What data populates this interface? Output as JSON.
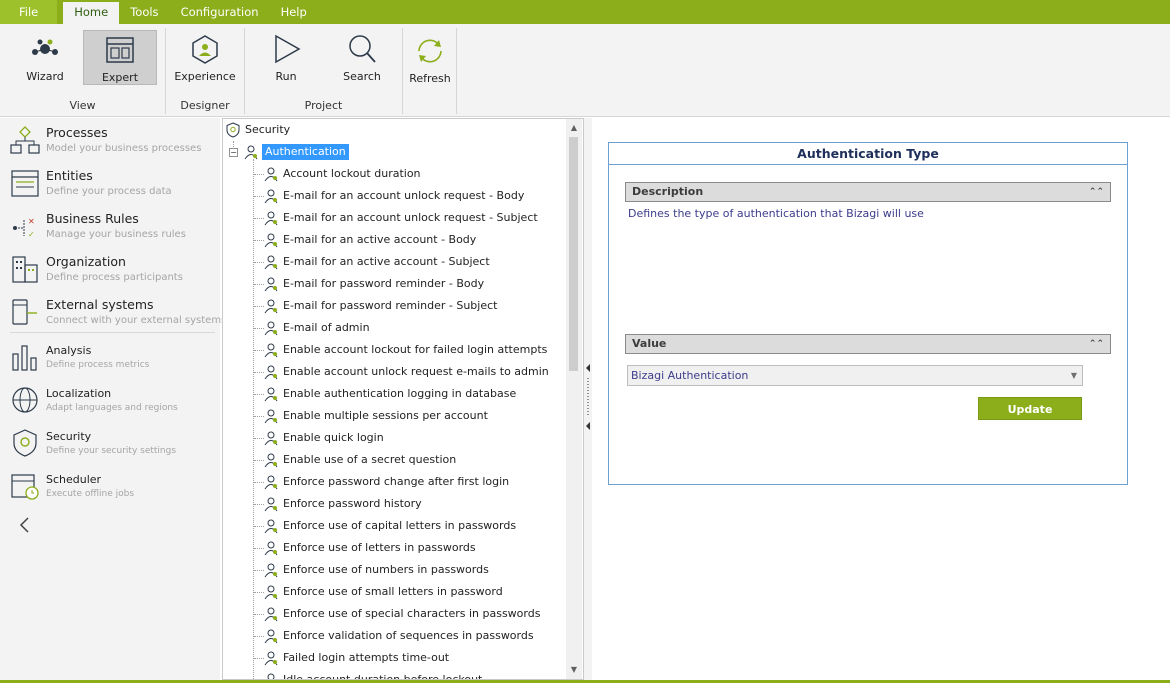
{
  "menu": {
    "items": [
      "File",
      "Home",
      "Tools",
      "Configuration",
      "Help"
    ],
    "active": "Home"
  },
  "ribbon": {
    "groups": [
      {
        "label": "View",
        "buttons": [
          {
            "label": "Wizard",
            "icon": "wizard-icon"
          },
          {
            "label": "Expert",
            "icon": "expert-icon",
            "selected": true
          }
        ]
      },
      {
        "label": "Designer",
        "buttons": [
          {
            "label": "Experience",
            "icon": "experience-icon"
          }
        ]
      },
      {
        "label": "Project",
        "buttons": [
          {
            "label": "Run",
            "icon": "run-icon"
          },
          {
            "label": "Search",
            "icon": "search-icon"
          }
        ]
      },
      {
        "label": "",
        "buttons": [
          {
            "label": "Refresh",
            "icon": "refresh-icon"
          }
        ]
      }
    ]
  },
  "sidebar": {
    "items": [
      {
        "title": "Processes",
        "desc": "Model your business processes",
        "icon": "processes-icon"
      },
      {
        "title": "Entities",
        "desc": "Define your process data",
        "icon": "entities-icon"
      },
      {
        "title": "Business Rules",
        "desc": "Manage your business rules",
        "icon": "business-rules-icon"
      },
      {
        "title": "Organization",
        "desc": "Define process participants",
        "icon": "organization-icon"
      },
      {
        "title": "External systems",
        "desc": "Connect with your external systems",
        "icon": "external-systems-icon"
      },
      {
        "title": "Analysis",
        "desc": "Define process metrics",
        "icon": "analysis-icon"
      },
      {
        "title": "Localization",
        "desc": "Adapt languages and regions",
        "icon": "localization-icon"
      },
      {
        "title": "Security",
        "desc": "Define your security settings",
        "icon": "security-icon"
      },
      {
        "title": "Scheduler",
        "desc": "Execute offline jobs",
        "icon": "scheduler-icon"
      }
    ]
  },
  "tree": {
    "root": "Security",
    "selected": "Authentication",
    "children": [
      "Account lockout duration",
      "E-mail for an account unlock request - Body",
      "E-mail for an account unlock request - Subject",
      "E-mail for an active account - Body",
      "E-mail for an active account - Subject",
      "E-mail for password reminder - Body",
      "E-mail for password reminder - Subject",
      "E-mail of admin",
      "Enable account lockout for failed login attempts",
      "Enable account unlock request e-mails to admin",
      "Enable authentication logging in database",
      "Enable multiple sessions per account",
      "Enable quick login",
      "Enable use of a secret question",
      "Enforce password change after first login",
      "Enforce password history",
      "Enforce use of capital letters in passwords",
      "Enforce use of letters in passwords",
      "Enforce use of numbers in passwords",
      "Enforce use of small letters in password",
      "Enforce use of special characters in passwords",
      "Enforce validation of sequences in passwords",
      "Failed login attempts time-out",
      "Idle account duration before lockout"
    ]
  },
  "panel": {
    "title": "Authentication Type",
    "description_label": "Description",
    "description": "Defines the type of authentication that Bizagi will use",
    "value_label": "Value",
    "value": "Bizagi Authentication",
    "update_label": "Update"
  },
  "colors": {
    "accent": "#8bae1a",
    "selection": "#3399ff",
    "panel_border": "#6f9fd0"
  }
}
